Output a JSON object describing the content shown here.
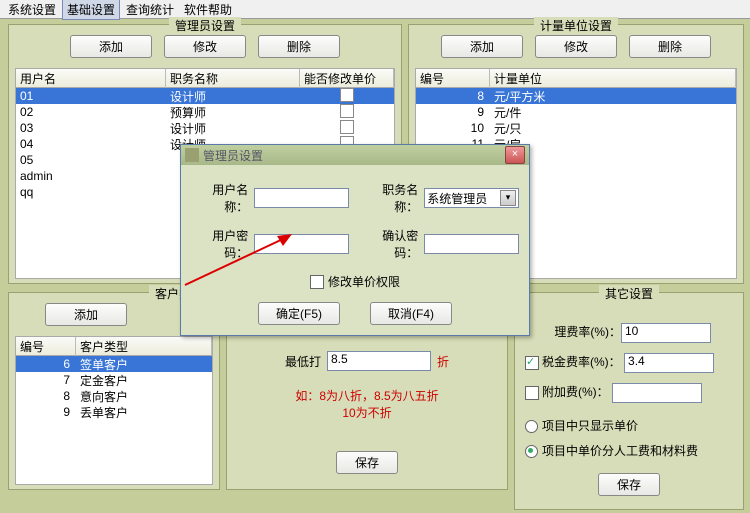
{
  "menu": {
    "items": [
      "系统设置",
      "基础设置",
      "查询统计",
      "软件帮助"
    ],
    "selected": 1
  },
  "admin": {
    "title": "管理员设置",
    "btns": {
      "add": "添加",
      "edit": "修改",
      "del": "删除"
    },
    "cols": {
      "user": "用户名",
      "job": "职务名称",
      "can": "能否修改单价"
    },
    "rows": [
      {
        "user": "01",
        "job": "设计师",
        "can": false,
        "sel": true
      },
      {
        "user": "02",
        "job": "预算师",
        "can": false
      },
      {
        "user": "03",
        "job": "设计师",
        "can": false
      },
      {
        "user": "04",
        "job": "设计师",
        "can": false
      },
      {
        "user": "05",
        "job": "",
        "can": false
      },
      {
        "user": "admin",
        "job": "",
        "can": false
      },
      {
        "user": "qq",
        "job": "",
        "can": false
      }
    ]
  },
  "unit": {
    "title": "计量单位设置",
    "btns": {
      "add": "添加",
      "edit": "修改",
      "del": "删除"
    },
    "cols": {
      "id": "编号",
      "name": "计量单位"
    },
    "rows": [
      {
        "id": "8",
        "name": "元/平方米",
        "sel": true
      },
      {
        "id": "9",
        "name": "元/件"
      },
      {
        "id": "10",
        "name": "元/只"
      },
      {
        "id": "11",
        "name": "元/扇"
      }
    ]
  },
  "cust": {
    "title": "客户类型",
    "btns": {
      "add": "添加"
    },
    "cols": {
      "id": "编号",
      "type": "客户类型"
    },
    "rows": [
      {
        "id": "6",
        "type": "签单客户",
        "sel": true
      },
      {
        "id": "7",
        "type": "定金客户"
      },
      {
        "id": "8",
        "type": "意向客户"
      },
      {
        "id": "9",
        "type": "丢单客户"
      }
    ]
  },
  "disc": {
    "lbl_min": "最低打",
    "val": "8.5",
    "unit": "折",
    "hint1": "如：8为八折，8.5为八五折",
    "hint2": "10为不折",
    "save": "保存"
  },
  "other": {
    "title": "其它设置",
    "mgmt_lbl": "理费率(%)：",
    "mgmt_val": "10",
    "tax_lbl": "税金费率(%)：",
    "tax_val": "3.4",
    "tax_on": true,
    "extra_lbl": "附加费(%)：",
    "extra_val": "",
    "extra_on": false,
    "opt1": "项目中只显示单价",
    "opt1_on": false,
    "opt2": "项目中单价分人工费和材料费",
    "opt2_on": true,
    "save": "保存"
  },
  "dlg": {
    "title": "管理员设置",
    "user_lbl": "用户名称：",
    "user_val": "",
    "job_lbl": "职务名称：",
    "job_val": "系统管理员",
    "pwd_lbl": "用户密码：",
    "pwd2_lbl": "确认密码：",
    "chk_lbl": "修改单价权限",
    "ok": "确定(F5)",
    "cancel": "取消(F4)"
  }
}
